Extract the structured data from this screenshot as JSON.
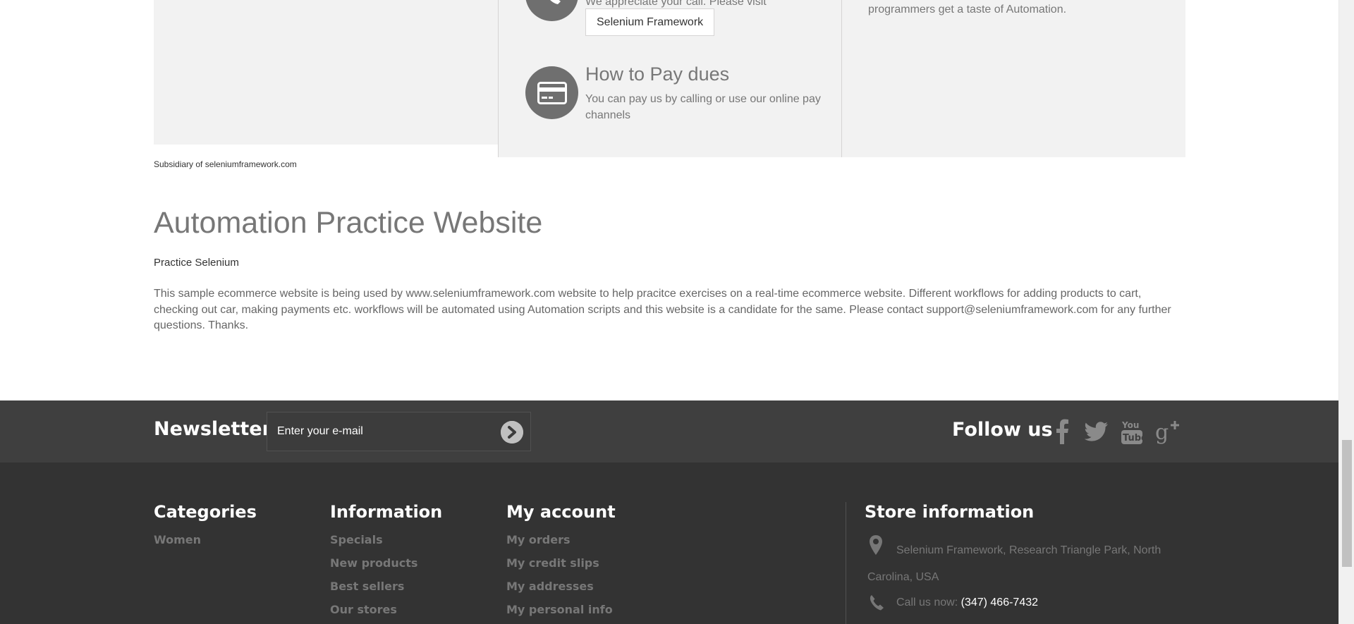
{
  "info": {
    "call_text": "We appreciate your call. Please visit",
    "selenium_button": "Selenium Framework",
    "pay_title": "How to Pay dues",
    "pay_desc": "You can pay us by calling or use our online pay channels",
    "right_text": "programmers get a taste of Automation."
  },
  "subsidiary": "Subsidiary of seleniumframework.com",
  "site": {
    "title": "Automation Practice Website",
    "subtitle": "Practice Selenium",
    "description": "This sample ecommerce website is being used by www.seleniumframework.com website to help pracitce exercises on a real-time ecommerce website. Different workflows for adding products to cart, checking out car, making payments etc. workflows will be automated using Automation scripts and this website is a candidate for the same. Please contact support@seleniumframework.com for any further questions. Thanks."
  },
  "newsletter": {
    "title": "Newsletter",
    "placeholder": "Enter your e-mail"
  },
  "follow": {
    "title": "Follow us",
    "icons": [
      "facebook-icon",
      "twitter-icon",
      "youtube-icon",
      "google-plus-icon"
    ]
  },
  "footer": {
    "categories": {
      "title": "Categories",
      "items": [
        "Women"
      ]
    },
    "information": {
      "title": "Information",
      "items": [
        "Specials",
        "New products",
        "Best sellers",
        "Our stores"
      ]
    },
    "account": {
      "title": "My account",
      "items": [
        "My orders",
        "My credit slips",
        "My addresses",
        "My personal info"
      ]
    },
    "store": {
      "title": "Store information",
      "address": "Selenium Framework, Research Triangle Park, North Carolina, USA",
      "call_label": "Call us now:",
      "phone": "(347) 466-7432"
    }
  },
  "colors": {
    "newsletter_bg": "#3f3f3f",
    "footer_bg": "#333333",
    "info_bg": "#f2f2f2",
    "icon_circle": "#6f6f6f"
  }
}
